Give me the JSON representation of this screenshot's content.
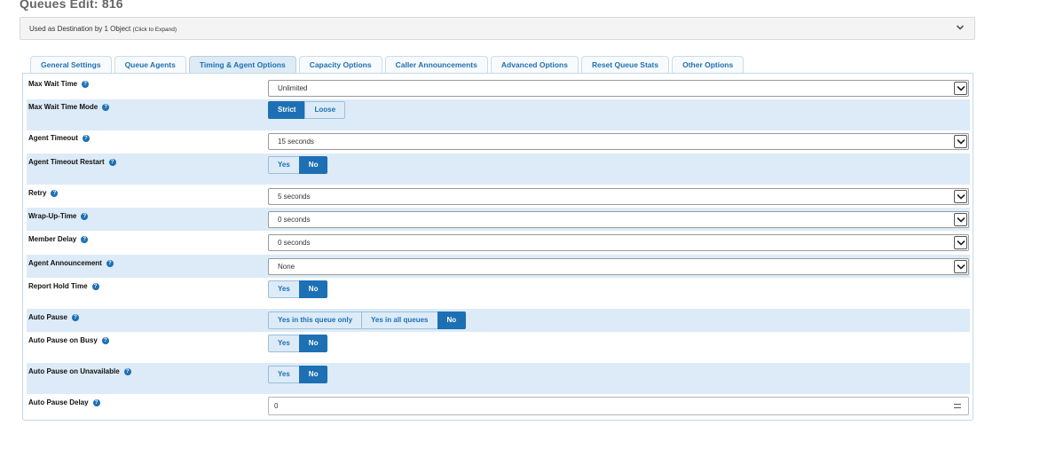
{
  "page": {
    "title": "Queues Edit: 816"
  },
  "usage": {
    "text": "Used as Destination by 1 Object",
    "hint": "(Click to Expand)"
  },
  "tabs": [
    {
      "label": "General Settings"
    },
    {
      "label": "Queue Agents"
    },
    {
      "label": "Timing & Agent Options",
      "active": true
    },
    {
      "label": "Capacity Options"
    },
    {
      "label": "Caller Announcements"
    },
    {
      "label": "Advanced Options"
    },
    {
      "label": "Reset Queue Stats"
    },
    {
      "label": "Other Options"
    }
  ],
  "form": {
    "max_wait_time": {
      "label": "Max Wait Time",
      "value": "Unlimited"
    },
    "max_wait_time_mode": {
      "label": "Max Wait Time Mode",
      "options": [
        "Strict",
        "Loose"
      ],
      "selected": "Strict"
    },
    "agent_timeout": {
      "label": "Agent Timeout",
      "value": "15 seconds"
    },
    "agent_timeout_restart": {
      "label": "Agent Timeout Restart",
      "options": [
        "Yes",
        "No"
      ],
      "selected": "No"
    },
    "retry": {
      "label": "Retry",
      "value": "5 seconds"
    },
    "wrap_up_time": {
      "label": "Wrap-Up-Time",
      "value": "0 seconds"
    },
    "member_delay": {
      "label": "Member Delay",
      "value": "0 seconds"
    },
    "agent_announcement": {
      "label": "Agent Announcement",
      "value": "None"
    },
    "report_hold_time": {
      "label": "Report Hold Time",
      "options": [
        "Yes",
        "No"
      ],
      "selected": "No"
    },
    "auto_pause": {
      "label": "Auto Pause",
      "options": [
        "Yes in this queue only",
        "Yes in all queues",
        "No"
      ],
      "selected": "No"
    },
    "auto_pause_on_busy": {
      "label": "Auto Pause on Busy",
      "options": [
        "Yes",
        "No"
      ],
      "selected": "No"
    },
    "auto_pause_on_unavailable": {
      "label": "Auto Pause on Unavailable",
      "options": [
        "Yes",
        "No"
      ],
      "selected": "No"
    },
    "auto_pause_delay": {
      "label": "Auto Pause Delay",
      "value": "0"
    }
  },
  "colors": {
    "accent": "#1d70b3",
    "row_shade": "#dcebf7",
    "title": "#666666"
  },
  "icons": {
    "help": "question-circle-icon",
    "expand": "chevron-down-icon",
    "select_arrow": "chevron-down-icon",
    "spinner": "number-spinner-icon"
  }
}
